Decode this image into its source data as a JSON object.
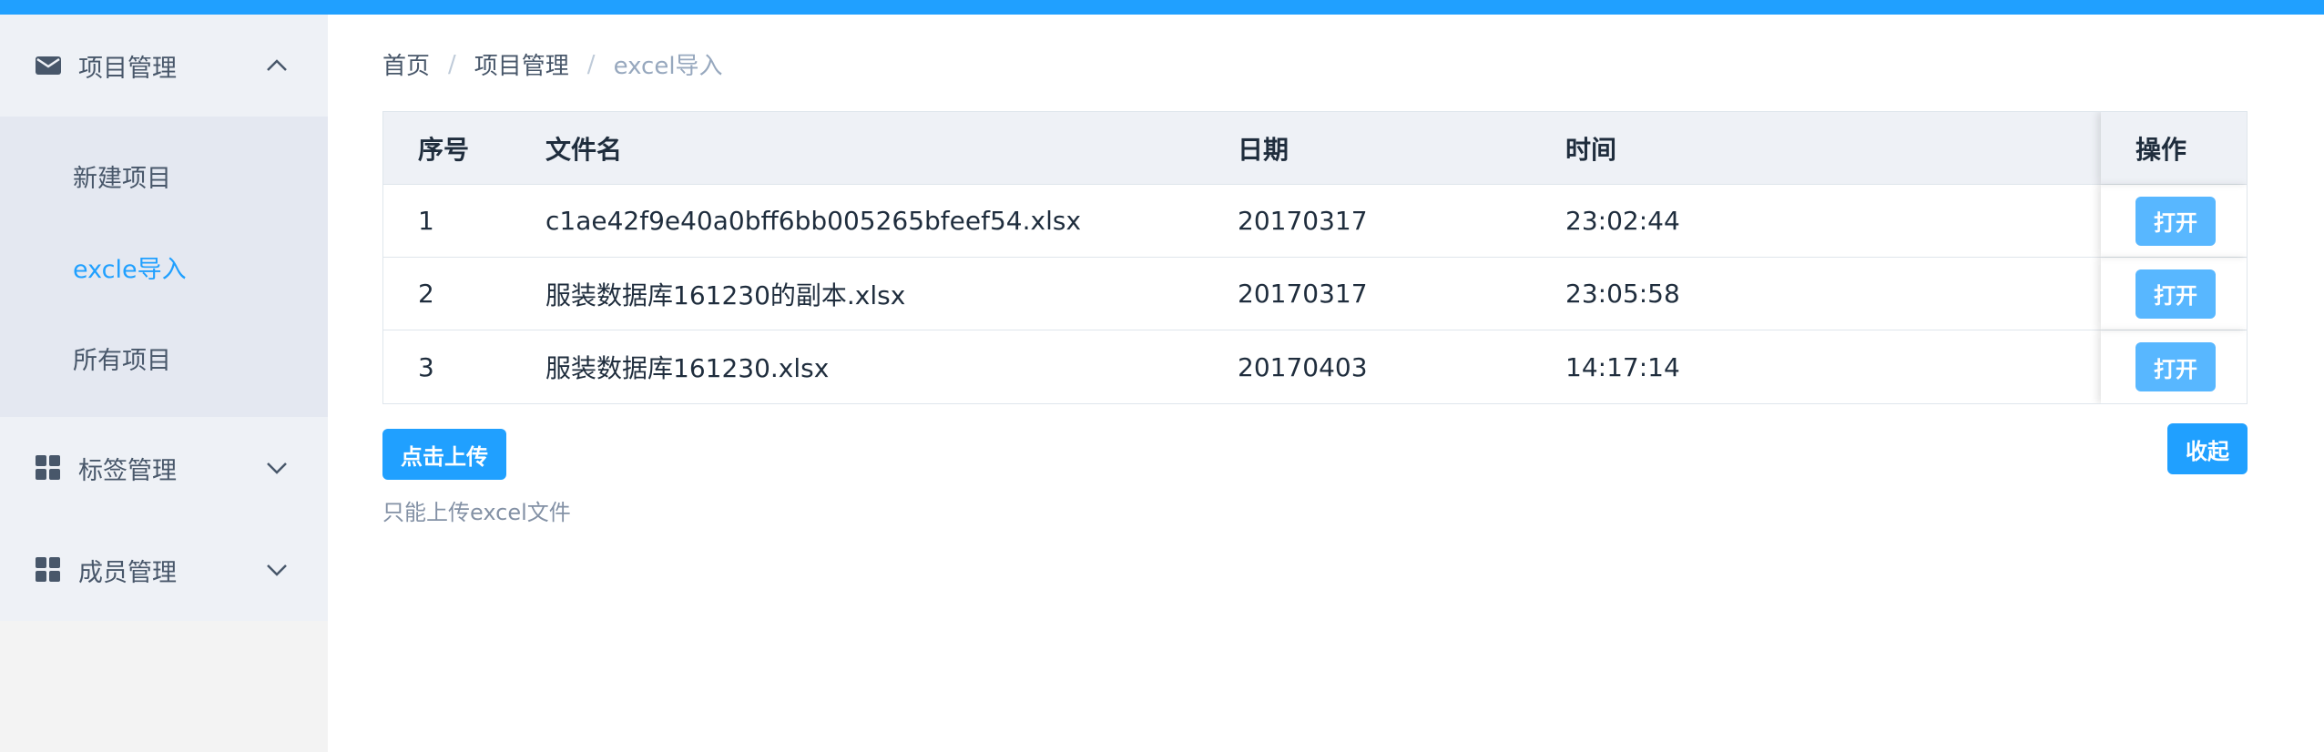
{
  "colors": {
    "accent": "#20a0ff",
    "sidebar_bg": "#eef1f6",
    "submenu_bg": "#e4e8f1",
    "open_button": "#58b7ff"
  },
  "sidebar": {
    "groups": [
      {
        "label": "项目管理",
        "icon": "envelope-icon",
        "expanded": true,
        "items": [
          {
            "label": "新建项目",
            "active": false
          },
          {
            "label": "excle导入",
            "active": true
          },
          {
            "label": "所有项目",
            "active": false
          }
        ]
      },
      {
        "label": "标签管理",
        "icon": "grid-icon",
        "expanded": false
      },
      {
        "label": "成员管理",
        "icon": "grid-icon",
        "expanded": false
      }
    ]
  },
  "breadcrumb": [
    "首页",
    "项目管理",
    "excel导入"
  ],
  "table": {
    "headers": {
      "index": "序号",
      "filename": "文件名",
      "date": "日期",
      "time": "时间",
      "action": "操作"
    },
    "rows": [
      {
        "index": "1",
        "filename": "c1ae42f9e40a0bff6bb005265bfeef54.xlsx",
        "date": "20170317",
        "time": "23:02:44",
        "action": "打开"
      },
      {
        "index": "2",
        "filename": "服装数据库161230的副本.xlsx",
        "date": "20170317",
        "time": "23:05:58",
        "action": "打开"
      },
      {
        "index": "3",
        "filename": "服装数据库161230.xlsx",
        "date": "20170403",
        "time": "14:17:14",
        "action": "打开"
      }
    ]
  },
  "upload": {
    "button_label": "点击上传",
    "tip": "只能上传excel文件"
  },
  "collapse_label": "收起"
}
